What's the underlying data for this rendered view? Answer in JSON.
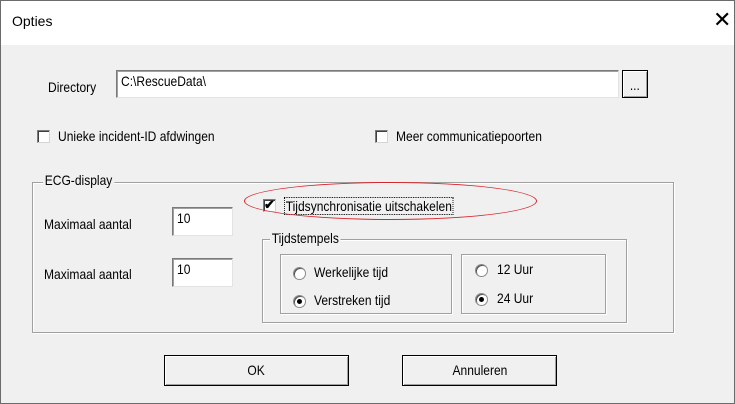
{
  "window": {
    "title": "Opties",
    "close_glyph": "✕"
  },
  "directory": {
    "label": "Directory",
    "value": "C:\\RescueData\\",
    "browse_label": "..."
  },
  "options": {
    "unique_incident": {
      "label": "Unieke incident-ID afdwingen",
      "checked": false
    },
    "more_ports": {
      "label": "Meer communicatiepoorten",
      "checked": false
    }
  },
  "ecg": {
    "group_label": "ECG-display",
    "max1": {
      "label": "Maximaal aantal",
      "value": "10"
    },
    "max2": {
      "label": "Maximaal aantal",
      "value": "10"
    },
    "time_sync": {
      "label": "Tijdsynchronisatie uitschakelen",
      "checked": true,
      "check_glyph": "✔"
    },
    "timestamps": {
      "group_label": "Tijdstempels",
      "time_mode": [
        {
          "label": "Werkelijke tijd",
          "selected": false
        },
        {
          "label": "Verstreken tijd",
          "selected": true
        }
      ],
      "clock_mode": [
        {
          "label": "12 Uur",
          "selected": false
        },
        {
          "label": "24 Uur",
          "selected": true
        }
      ]
    }
  },
  "buttons": {
    "ok": "OK",
    "cancel": "Annuleren"
  },
  "colors": {
    "highlight_oval": "#d9232a",
    "dialog_bg": "#f0f0f0"
  }
}
